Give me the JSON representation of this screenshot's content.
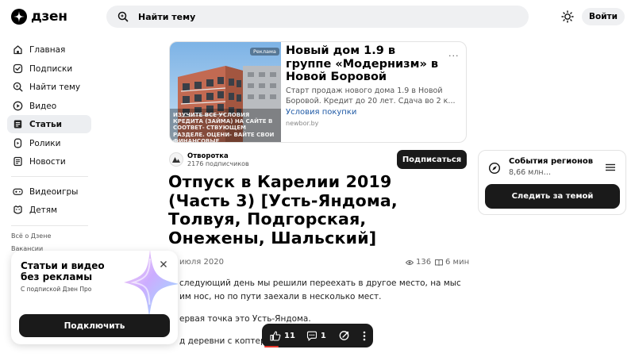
{
  "header": {
    "logo_text": "дзен",
    "search_placeholder": "Найти тему",
    "login_label": "Войти"
  },
  "sidebar": {
    "items": [
      {
        "label": "Главная",
        "icon": "home-icon"
      },
      {
        "label": "Подписки",
        "icon": "subscriptions-icon"
      },
      {
        "label": "Найти тему",
        "icon": "find-topic-icon"
      },
      {
        "label": "Видео",
        "icon": "video-icon"
      },
      {
        "label": "Статьи",
        "icon": "articles-icon",
        "active": true
      },
      {
        "label": "Ролики",
        "icon": "shorts-icon"
      },
      {
        "label": "Новости",
        "icon": "news-icon"
      },
      {
        "label": "Видеоигры",
        "icon": "gamepad-icon"
      },
      {
        "label": "Детям",
        "icon": "kids-icon"
      }
    ],
    "footer_links": [
      "Всё о Дзене",
      "Вакансии"
    ]
  },
  "promo": {
    "title": "Статьи и видео без рекламы",
    "subtitle": "С подпиской Дзен Про",
    "button_label": "Подключить"
  },
  "ad": {
    "badge": "Реклама",
    "image_overlay_text": "ИЗУЧИТЕ ВСЕ УСЛОВИЯ КРЕДИТА (ЗАЙМА) НА САЙТЕ В СООТВЕТ- СТВУЮЩЕМ РАЗДЕЛЕ. ОЦЕНИ- ВАЙТЕ СВОИ ФИНАНСОВЫЕ",
    "title": "Новый дом 1.9 в группе «Модернизм» в Новой Боровой",
    "description": "Старт продаж нового дома 1.9 в Новой Боровой. Кредит до 20 лет. Сдача во 2 к...",
    "cta": "Условия покупки",
    "domain": "newbor.by",
    "more": "..."
  },
  "channel": {
    "name": "Отворотка",
    "subscribers": "2176 подписчиков",
    "subscribe_label": "Подписаться"
  },
  "article": {
    "title": "Отпуск в Карелии 2019 (Часть 3) [Усть-Яндома, Толвуя, Подгорская, Онежены, Шальский]",
    "date": "июля 2020",
    "views": "136",
    "read_time": "6 мин",
    "paragraphs": [
      "следующий день мы решили переехать в другое место, на мыс",
      "им нос, но по пути заехали в несколько мест.",
      "ервая точка это Усть-Яндома.",
      "д деревни с коптер"
    ]
  },
  "actions": {
    "likes": "11",
    "comments": "1"
  },
  "topic_widget": {
    "name": "События регионов",
    "count": "8,66 млн…",
    "button_label": "Следить за темой"
  },
  "colors": {
    "accent_dark": "#1a1a1a",
    "link_blue": "#1f5aa6",
    "active_nav_bg": "#eceef1",
    "progress_red": "#e5362c"
  }
}
